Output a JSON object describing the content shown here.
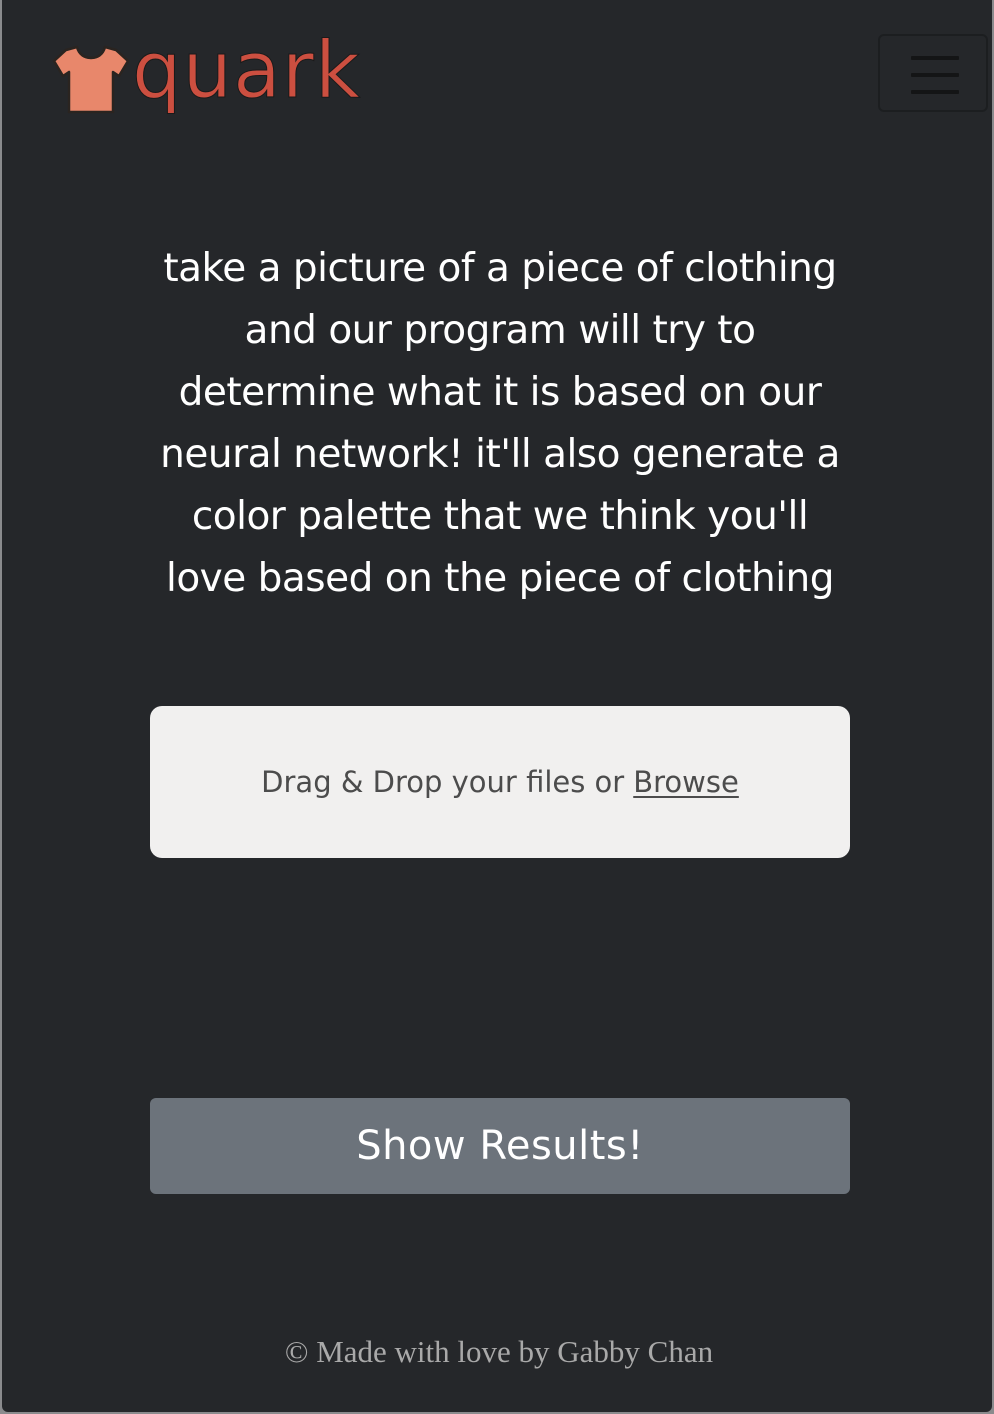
{
  "brand": {
    "name": "quark",
    "icon": "tshirt-icon",
    "color": "#cc4f40",
    "icon_color": "#e8876b"
  },
  "nav": {
    "toggler_icon": "hamburger-menu-icon"
  },
  "intro": {
    "text": "take a picture of a piece of clothing and our program will try to determine what it is based on our neural network! it'll also generate a color palette that we think you'll love based on the piece of clothing"
  },
  "upload": {
    "prompt": "Drag & Drop your files or",
    "browse_label": "Browse"
  },
  "results_button": {
    "label": "Show Results!"
  },
  "footer": {
    "text": "© Made with love by Gabby Chan"
  },
  "colors": {
    "background": "#25272a",
    "dropzone": "#f1f0ef",
    "button": "#6c737b"
  }
}
